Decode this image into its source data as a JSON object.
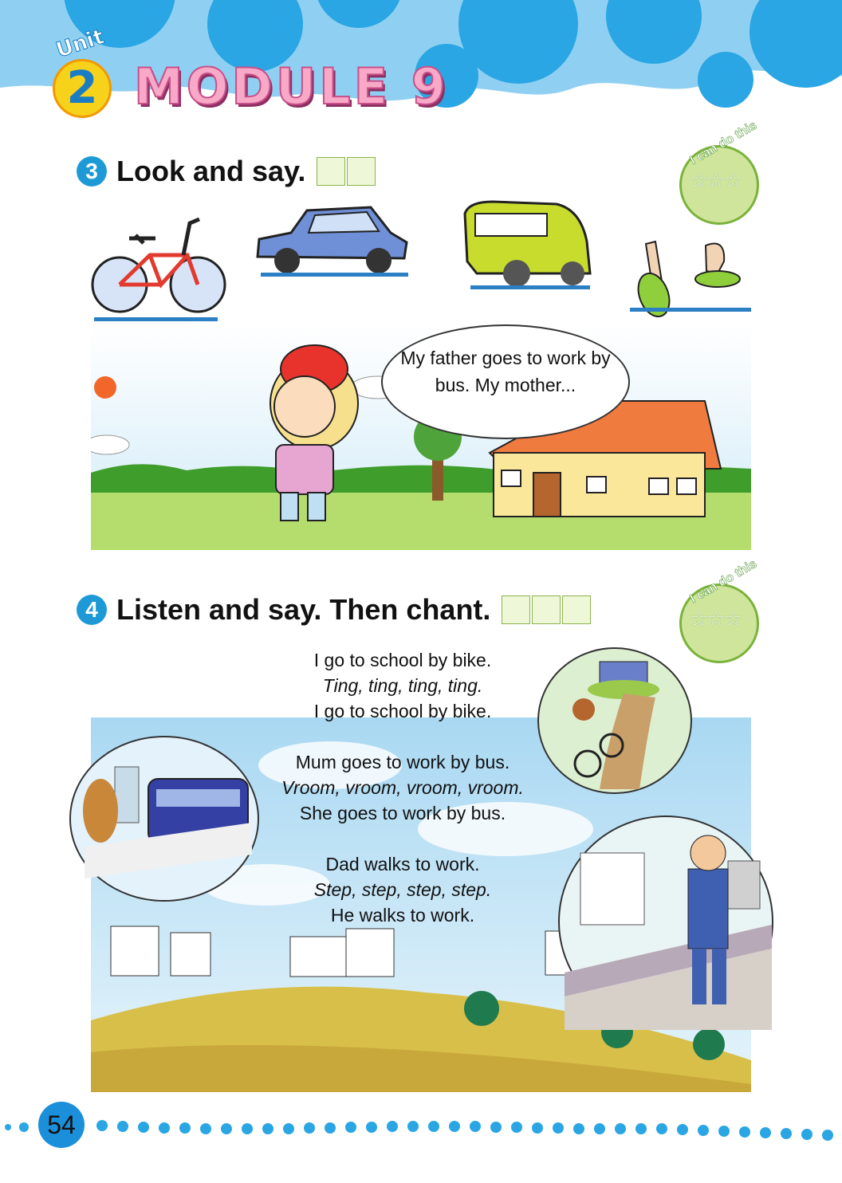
{
  "header": {
    "unit_label": "Unit",
    "unit_number": "2",
    "module_title": "MODULE 9"
  },
  "section3": {
    "number": "3",
    "title": "Look and say.",
    "badge_text": "I can do this",
    "bubble_text": "My father goes to work by bus. My mother..."
  },
  "section4": {
    "number": "4",
    "title": "Listen and say. Then chant.",
    "badge_text": "I can do this",
    "chant": [
      {
        "line1": "I go to school by bike.",
        "line2": "Ting, ting, ting, ting.",
        "line3": "I go to school by bike."
      },
      {
        "line1": "Mum goes to work by bus.",
        "line2": "Vroom, vroom, vroom, vroom.",
        "line3": "She goes to work by bus."
      },
      {
        "line1": "Dad walks to work.",
        "line2": "Step, step, step, step.",
        "line3": "He walks to work."
      }
    ]
  },
  "footer": {
    "page_number": "54"
  },
  "colors": {
    "sky_blue": "#8fd0f2",
    "accent_blue": "#1d9ad6",
    "grass_green": "#9ccf55",
    "module_pink": "#f7a9c7"
  }
}
